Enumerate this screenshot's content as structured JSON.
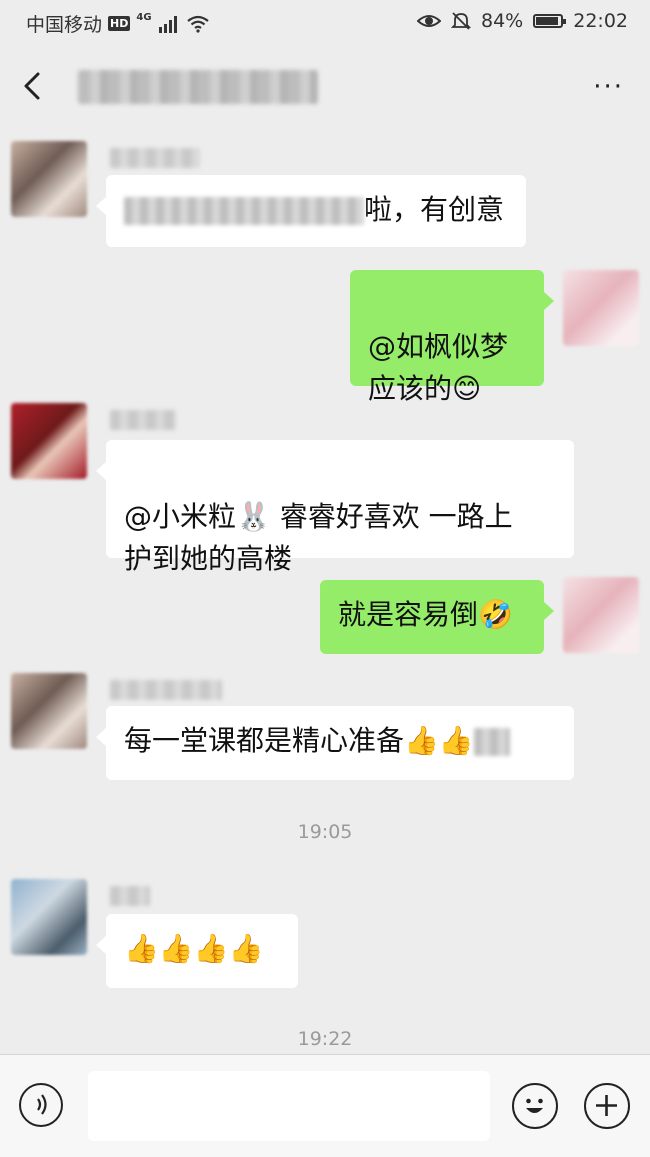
{
  "status_bar": {
    "carrier": "中国移动",
    "hd": "HD",
    "network": "4G",
    "battery": "84%",
    "battery_level": 0.84,
    "time": "22:02"
  },
  "header": {
    "more_label": "···"
  },
  "messages": [
    {
      "from": "other",
      "sender": "如枫似梦",
      "text": "啦，有创意"
    },
    {
      "from": "me",
      "text": "@如枫似梦\n应该的😊"
    },
    {
      "from": "other",
      "sender": "郑佳燕",
      "text": "@小米粒🐰 睿睿好喜欢 一路上\n护到她的高楼"
    },
    {
      "from": "me",
      "text": "就是容易倒🤣"
    },
    {
      "from": "other",
      "sender": "如枫似梦",
      "text": "每一堂课都是精心准备👍👍"
    },
    {
      "from": "other",
      "sender": "晔",
      "text": "👍👍👍👍"
    }
  ],
  "timestamps": [
    "19:05",
    "19:22"
  ],
  "input": {
    "value": "",
    "placeholder": ""
  },
  "colors": {
    "background": "#ededed",
    "outgoing_bubble": "#95ec69",
    "incoming_bubble": "#ffffff"
  }
}
